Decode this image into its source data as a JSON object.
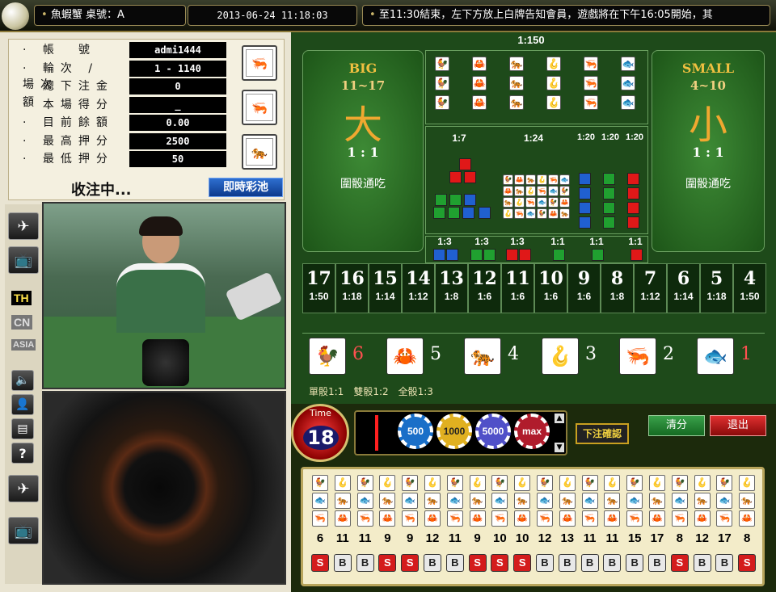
{
  "header": {
    "game_title": "魚蝦蟹 桌號：A",
    "datetime": "2013-06-24 11:18:03",
    "marquee": "至11:30結束，左下方放上白牌告知會員，遊戲將在下午16:05開始，",
    "marquee_end": "其"
  },
  "account": {
    "rows": [
      {
        "label": "· 帳　號",
        "value": "admi1444"
      },
      {
        "label": "· 輪次 / 場次",
        "value": "1 - 1140"
      },
      {
        "label": "· 總下注金額",
        "value": "0"
      },
      {
        "label": "· 本場得分",
        "value": "_"
      },
      {
        "label": "· 目前餘額",
        "value": "0.00"
      },
      {
        "label": "· 最高押分",
        "value": "2500"
      },
      {
        "label": "· 最低押分",
        "value": "50"
      }
    ],
    "status": "收注中...",
    "jackpot_button": "即時彩池"
  },
  "languages": [
    "TH",
    "CN",
    "ASIA"
  ],
  "board": {
    "top_odds": "1:150",
    "big": {
      "en": "BIG",
      "range": "11~17",
      "zh": "大",
      "odds": "1 : 1",
      "note": "圍骰通吃"
    },
    "small": {
      "en": "SMALL",
      "range": "4~10",
      "zh": "小",
      "odds": "1 : 1",
      "note": "圍骰通吃"
    },
    "mid_odds": [
      "1:7",
      "1:24",
      "1:20",
      "1:20",
      "1:20"
    ],
    "pair_odds": [
      "1:3",
      "1:3",
      "1:3",
      "1:1",
      "1:1",
      "1:1"
    ],
    "totals": [
      {
        "n": "17",
        "p": "1:50"
      },
      {
        "n": "16",
        "p": "1:18"
      },
      {
        "n": "15",
        "p": "1:14"
      },
      {
        "n": "14",
        "p": "1:12"
      },
      {
        "n": "13",
        "p": "1:8"
      },
      {
        "n": "12",
        "p": "1:6"
      },
      {
        "n": "11",
        "p": "1:6"
      },
      {
        "n": "10",
        "p": "1:6"
      },
      {
        "n": "9",
        "p": "1:6"
      },
      {
        "n": "8",
        "p": "1:8"
      },
      {
        "n": "7",
        "p": "1:12"
      },
      {
        "n": "6",
        "p": "1:14"
      },
      {
        "n": "5",
        "p": "1:18"
      },
      {
        "n": "4",
        "p": "1:50"
      }
    ],
    "symbols": [
      {
        "icon": "rooster-icon",
        "glyph": "🐓",
        "num": "6",
        "color": "#d62020"
      },
      {
        "icon": "crab-icon",
        "glyph": "🦀",
        "num": "5",
        "color": "#2a8a2a"
      },
      {
        "icon": "tiger-icon",
        "glyph": "🐅",
        "num": "4",
        "color": "#2060c0"
      },
      {
        "icon": "gourd-icon",
        "glyph": "🪝",
        "num": "3",
        "color": "#2060c0"
      },
      {
        "icon": "shrimp-icon",
        "glyph": "🦐",
        "num": "2",
        "color": "#2a8a2a"
      },
      {
        "icon": "fish-icon",
        "glyph": "🐟",
        "num": "1",
        "color": "#d62020"
      }
    ],
    "payout_note": "單骰1:1　雙骰1:2　全骰1:3"
  },
  "controls": {
    "time_label": "Time",
    "time_value": "18",
    "chips": [
      {
        "label": "500",
        "color": "#1a6fc8"
      },
      {
        "label": "1000",
        "color": "#e0b020"
      },
      {
        "label": "5000",
        "color": "#5050c8"
      },
      {
        "label": "max",
        "color": "#b01c2c"
      }
    ],
    "confirm_button": "下注確認",
    "clear_button": "清分",
    "exit_button": "退出"
  },
  "history": {
    "totals": [
      "6",
      "11",
      "11",
      "9",
      "9",
      "12",
      "11",
      "9",
      "10",
      "10",
      "12",
      "13",
      "11",
      "11",
      "15",
      "17",
      "8",
      "12",
      "17",
      "8"
    ],
    "results": [
      "S",
      "B",
      "B",
      "S",
      "S",
      "B",
      "B",
      "S",
      "S",
      "S",
      "B",
      "B",
      "B",
      "B",
      "B",
      "B",
      "S",
      "B",
      "B",
      "S"
    ],
    "colors": {
      "S": "#d41c1c",
      "B": "#e8e8e8"
    }
  }
}
